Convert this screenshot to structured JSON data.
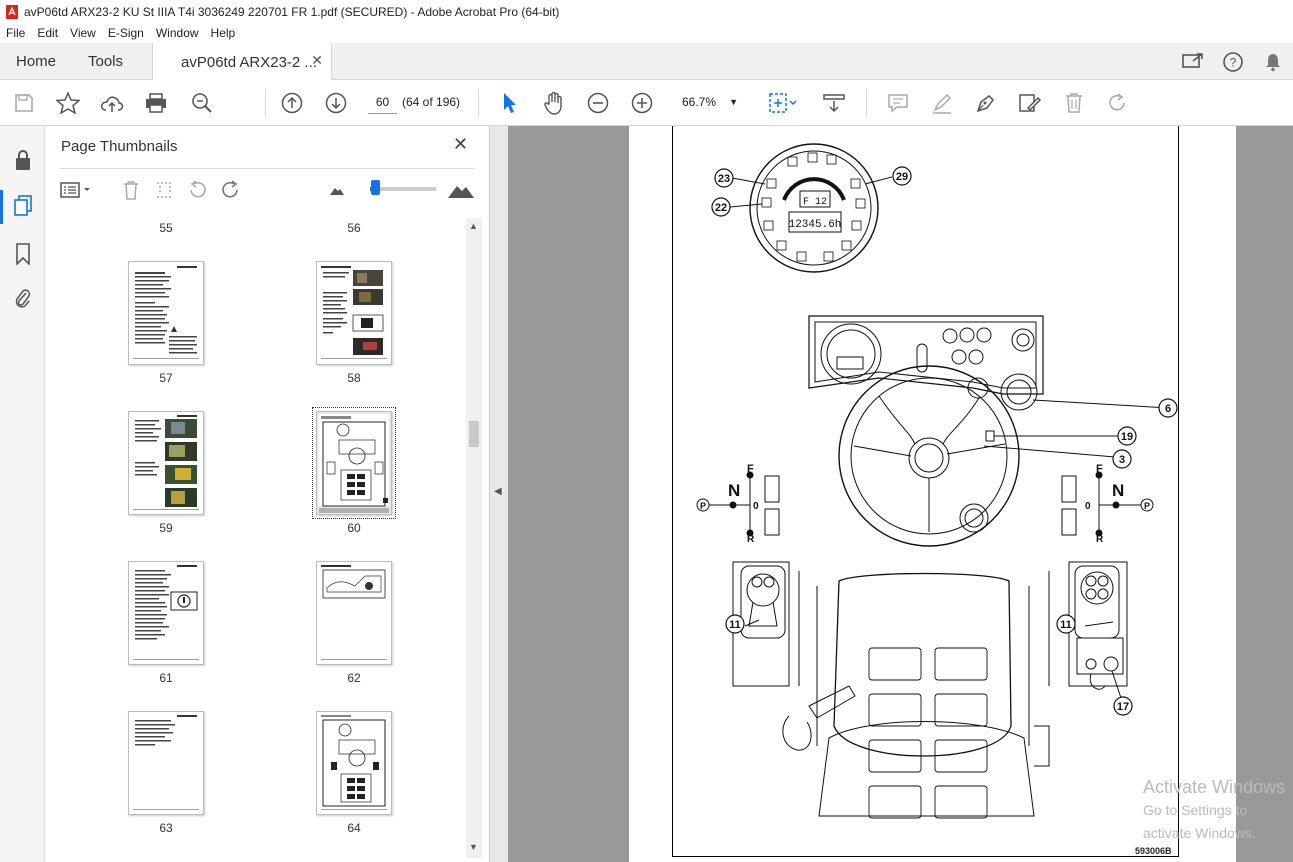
{
  "window": {
    "title": "avP06td ARX23-2 KU St IIIA T4i 3036249 220701 FR 1.pdf (SECURED) - Adobe Acrobat Pro (64-bit)"
  },
  "menu": [
    "File",
    "Edit",
    "View",
    "E-Sign",
    "Window",
    "Help"
  ],
  "tabs": {
    "home": "Home",
    "tools": "Tools",
    "document": "avP06td ARX23-2 ..."
  },
  "toolbar": {
    "page_current": "60",
    "page_count": "(64 of 196)",
    "zoom": "66.7%"
  },
  "panel": {
    "title": "Page Thumbnails",
    "thumbnail_zoom_fraction": 0.08
  },
  "thumbnails": [
    {
      "label": "55"
    },
    {
      "label": "56"
    },
    {
      "label": "57"
    },
    {
      "label": "58"
    },
    {
      "label": "59"
    },
    {
      "label": "60",
      "selected": true
    },
    {
      "label": "61"
    },
    {
      "label": "62"
    },
    {
      "label": "63"
    },
    {
      "label": "64"
    }
  ],
  "document": {
    "figure_code": "593006B",
    "callouts": [
      "23",
      "29",
      "22",
      "6",
      "19",
      "3",
      "11",
      "11",
      "17"
    ],
    "dash_display": "F 12",
    "hour_meter": "12345.6h",
    "gear_left": {
      "forward": "F",
      "neutral": "N",
      "zero": "0",
      "reverse": "R",
      "park": "P"
    },
    "gear_right": {
      "forward": "F",
      "neutral": "N",
      "zero": "0",
      "reverse": "R",
      "park": "P"
    }
  },
  "watermark": {
    "line1": "Activate Windows",
    "line2": "Go to Settings to activate Windows."
  },
  "colors": {
    "accent": "#1473e6",
    "doc_background": "#999999",
    "pdf_red": "#d9261c"
  }
}
